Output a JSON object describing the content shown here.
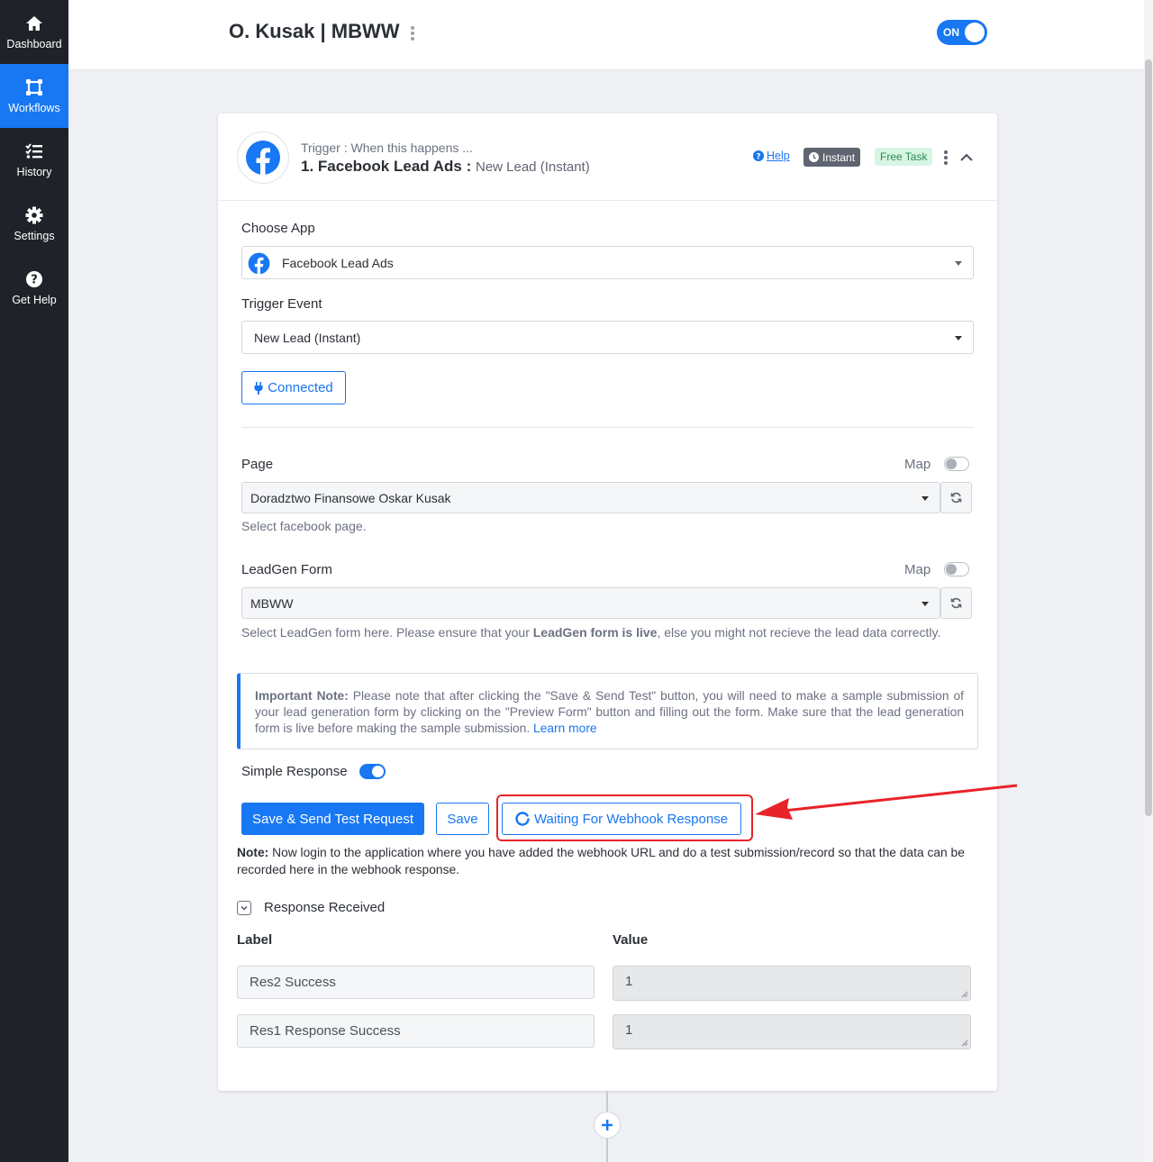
{
  "sidebar": {
    "items": [
      {
        "label": "Dashboard",
        "icon": "home-icon"
      },
      {
        "label": "Workflows",
        "icon": "workflow-icon",
        "active": true
      },
      {
        "label": "History",
        "icon": "history-icon"
      },
      {
        "label": "Settings",
        "icon": "gear-icon"
      },
      {
        "label": "Get Help",
        "icon": "question-icon"
      }
    ]
  },
  "header": {
    "title": "O. Kusak | MBWW",
    "toggle_label": "ON"
  },
  "trigger": {
    "subtitle": "Trigger : When this happens ...",
    "title": "1. Facebook Lead Ads :",
    "event": "New Lead (Instant)",
    "help_label": "Help",
    "instant_label": "Instant",
    "free_task_label": "Free Task"
  },
  "form": {
    "choose_app_label": "Choose App",
    "choose_app_value": "Facebook Lead Ads",
    "trigger_event_label": "Trigger Event",
    "trigger_event_value": "New Lead (Instant)",
    "connected_label": "Connected",
    "page_label": "Page",
    "page_map_label": "Map",
    "page_value": "Doradztwo Finansowe Oskar Kusak",
    "page_help": "Select facebook page.",
    "leadgen_label": "LeadGen Form",
    "leadgen_map_label": "Map",
    "leadgen_value": "MBWW",
    "leadgen_help_pre": "Select LeadGen form here. Please ensure that your ",
    "leadgen_help_bold": "LeadGen form is live",
    "leadgen_help_post": ", else you might not recieve the lead data correctly."
  },
  "important_note": {
    "bold": "Important Note:",
    "text": " Please note that after clicking the \"Save & Send Test\" button, you will need to make a sample submission of your lead generation form by clicking on the \"Preview Form\" button and filling out the form. Make sure that the lead generation form is live before making the sample submission. ",
    "link": "Learn more"
  },
  "simple_response_label": "Simple Response",
  "buttons": {
    "save_send": "Save & Send Test Request",
    "save": "Save",
    "waiting": "Waiting For Webhook Response"
  },
  "webhook_note": {
    "bold": "Note:",
    "text": " Now login to the application where you have added the webhook URL and do a test submission/record so that the data can be recorded here in the webhook response."
  },
  "response": {
    "title": "Response Received",
    "label_header": "Label",
    "value_header": "Value",
    "rows": [
      {
        "label": "Res2 Success",
        "value": "1"
      },
      {
        "label": "Res1 Response Success",
        "value": "1"
      }
    ]
  },
  "colors": {
    "accent": "#1877f2",
    "sidebar_bg": "#1f2329",
    "highlight": "#e8232a"
  }
}
